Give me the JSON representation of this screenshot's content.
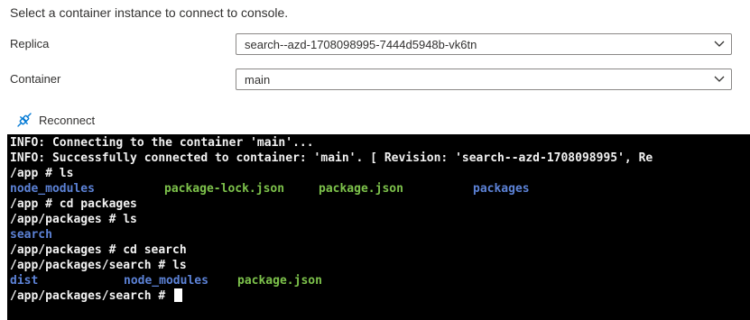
{
  "instruction": "Select a container instance to connect to console.",
  "replica": {
    "label": "Replica",
    "value": "search--azd-1708098995-7444d5948b-vk6tn",
    "chevron_icon": "chevron-down-icon"
  },
  "container": {
    "label": "Container",
    "value": "main",
    "chevron_icon": "chevron-down-icon"
  },
  "reconnect": {
    "label": "Reconnect",
    "icon": "plug-icon"
  },
  "terminal": {
    "lines": [
      "INFO: Connecting to the container 'main'...",
      "INFO: Successfully connected to container: 'main'. [ Revision: 'search--azd-1708098995', Re",
      "/app # ls",
      "",
      "/app # cd packages",
      "/app/packages # ls",
      "",
      "/app/packages # cd search",
      "/app/packages/search # ls",
      "",
      "/app/packages/search # "
    ],
    "ls_app": [
      "node_modules",
      "package-lock.json",
      "package.json",
      "packages"
    ],
    "ls_packages": [
      "search"
    ],
    "ls_search": [
      "dist",
      "node_modules",
      "package.json"
    ]
  },
  "colors": {
    "directory": "#5c82d6",
    "file": "#7dc24b",
    "terminal_bg": "#000000"
  }
}
